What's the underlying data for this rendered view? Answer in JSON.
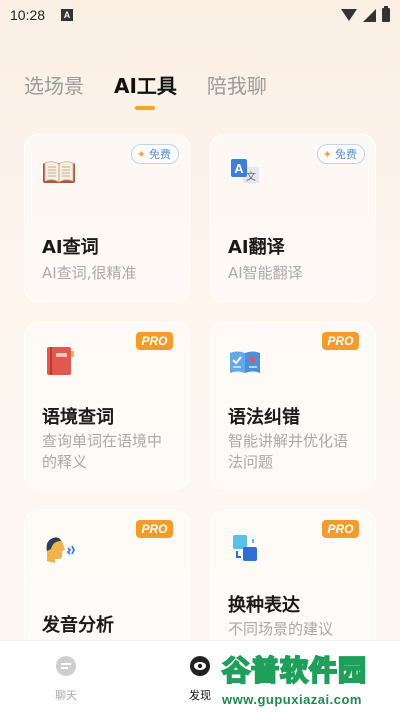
{
  "status_bar": {
    "time": "10:28",
    "notification": "A"
  },
  "tabs": [
    {
      "label": "选场景"
    },
    {
      "label": "AI工具"
    },
    {
      "label": "陪我聊"
    }
  ],
  "badges": {
    "free": "免费",
    "pro": "PRO"
  },
  "cards": [
    {
      "title": "AI查词",
      "desc": "AI查词,很精准",
      "badge": "free",
      "icon": "book-icon"
    },
    {
      "title": "AI翻译",
      "desc": "AI智能翻译",
      "badge": "free",
      "icon": "translate-icon"
    },
    {
      "title": "语境查词",
      "desc": "查询单词在语境中的释义",
      "badge": "pro",
      "icon": "notebook-icon"
    },
    {
      "title": "语法纠错",
      "desc": "智能讲解并优化语法问题",
      "badge": "pro",
      "icon": "grammar-icon"
    },
    {
      "title": "发音分析",
      "desc": "",
      "badge": "pro",
      "icon": "pronunciation-icon"
    },
    {
      "title": "换种表达",
      "desc": "不同场景的建议",
      "badge": "pro",
      "icon": "rephrase-icon"
    }
  ],
  "bottom_nav": [
    {
      "label": "聊天",
      "icon": "chat-icon"
    },
    {
      "label": "发现",
      "icon": "discover-icon"
    }
  ],
  "watermark": {
    "title": "谷普软件园",
    "url": "www.gupuxiazai.com"
  },
  "colors": {
    "accent": "#f5a623",
    "pro": "#f39b2b",
    "free_text": "#5d8fd1"
  }
}
